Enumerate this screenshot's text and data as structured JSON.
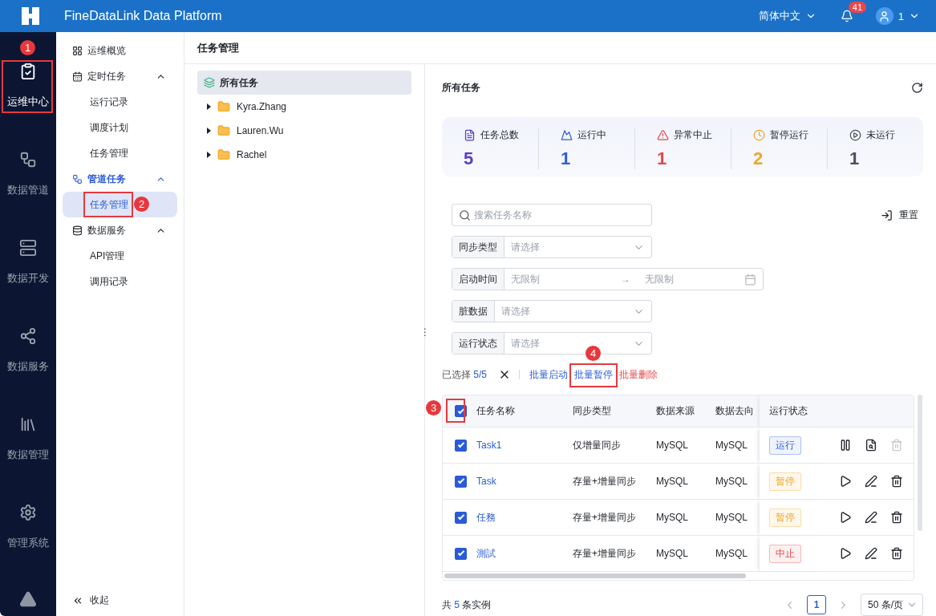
{
  "header": {
    "title": "FineDataLink Data Platform",
    "language": "简体中文",
    "notifications": "41",
    "user": "1"
  },
  "rail": {
    "items": [
      {
        "label": "运维中心",
        "selected": true,
        "callout": {
          "number": "1"
        }
      },
      {
        "label": "数据管道",
        "selected": false
      },
      {
        "label": "数据开发",
        "selected": false
      },
      {
        "label": "数据服务",
        "selected": false
      },
      {
        "label": "数据管理",
        "selected": false
      },
      {
        "label": "管理系统",
        "selected": false
      }
    ]
  },
  "sidebar": {
    "items": [
      {
        "label": "运维概览",
        "kind": "link",
        "selected": false
      },
      {
        "label": "定时任务",
        "kind": "group",
        "selected": false,
        "expanded": true,
        "children": [
          {
            "label": "运行记录",
            "selected": false
          },
          {
            "label": "调度计划",
            "selected": false
          },
          {
            "label": "任务管理",
            "selected": false
          }
        ]
      },
      {
        "label": "管道任务",
        "kind": "group",
        "selected": true,
        "expanded": true,
        "children": [
          {
            "label": "任务管理",
            "selected": true,
            "callout": {
              "number": "2"
            }
          }
        ]
      },
      {
        "label": "数据服务",
        "kind": "group",
        "selected": false,
        "expanded": true,
        "children": [
          {
            "label": "API管理",
            "selected": false
          },
          {
            "label": "调用记录",
            "selected": false
          }
        ]
      }
    ],
    "collapse": "收起"
  },
  "page_title": "任务管理",
  "tree": {
    "root": {
      "label": "所有任务",
      "selected": true
    },
    "folders": [
      {
        "label": "Kyra.Zhang",
        "expanded": false
      },
      {
        "label": "Lauren.Wu",
        "expanded": false
      },
      {
        "label": "Rachel",
        "expanded": false
      }
    ]
  },
  "panel": {
    "resize_handle": "⋮",
    "title": "所有任务",
    "stats": [
      {
        "label": "任务总数",
        "value": "5",
        "color": "#5b3fc4"
      },
      {
        "label": "运行中",
        "value": "1",
        "color": "#2f5ed8"
      },
      {
        "label": "异常中止",
        "value": "1",
        "color": "#e2474b"
      },
      {
        "label": "暂停运行",
        "value": "2",
        "color": "#f0a42a"
      },
      {
        "label": "未运行",
        "value": "1",
        "color": "#4a4f5c"
      }
    ],
    "search": {
      "placeholder": "搜索任务名称"
    },
    "reset": "重置",
    "filters": [
      {
        "kind": "select",
        "label": "同步类型",
        "placeholder": "请选择"
      },
      {
        "kind": "range",
        "label": "启动时间",
        "from": "无限制",
        "separator": "→",
        "to": "无限制"
      },
      {
        "kind": "select",
        "label": "脏数据",
        "placeholder": "请选择"
      },
      {
        "kind": "select",
        "label": "运行状态",
        "placeholder": "请选择"
      }
    ],
    "selection": {
      "label": "已选择",
      "count": "5/5"
    },
    "batch_actions": [
      {
        "label": "批量启动",
        "kind": "primary"
      },
      {
        "label": "批量暂停",
        "kind": "primary",
        "callout": {
          "number": "4"
        }
      },
      {
        "label": "批量删除",
        "kind": "danger"
      }
    ],
    "table": {
      "all_checked": true,
      "header_callout": {
        "number": "3"
      },
      "columns": [
        "任务名称",
        "同步类型",
        "数据来源",
        "数据去向",
        "运行状态"
      ],
      "rows": [
        {
          "checked": true,
          "name": "Task1",
          "sync": "仅增量同步",
          "source": "MySQL",
          "target": "MySQL",
          "status": {
            "label": "运行",
            "kind": "running"
          },
          "actions": [
            {
              "kind": "pause",
              "disabled": false
            },
            {
              "kind": "detail",
              "disabled": false
            },
            {
              "kind": "delete",
              "disabled": true
            }
          ]
        },
        {
          "checked": true,
          "name": "Task",
          "sync": "存量+增量同步",
          "source": "MySQL",
          "target": "MySQL",
          "status": {
            "label": "暂停",
            "kind": "paused"
          },
          "actions": [
            {
              "kind": "play",
              "disabled": false
            },
            {
              "kind": "edit",
              "disabled": false
            },
            {
              "kind": "delete",
              "disabled": false
            }
          ]
        },
        {
          "checked": true,
          "name": "任務",
          "sync": "存量+增量同步",
          "source": "MySQL",
          "target": "MySQL",
          "status": {
            "label": "暂停",
            "kind": "paused"
          },
          "actions": [
            {
              "kind": "play",
              "disabled": false
            },
            {
              "kind": "edit",
              "disabled": false
            },
            {
              "kind": "delete",
              "disabled": false
            }
          ]
        },
        {
          "checked": true,
          "name": "測試",
          "sync": "存量+增量同步",
          "source": "MySQL",
          "target": "MySQL",
          "status": {
            "label": "中止",
            "kind": "stopped"
          },
          "actions": [
            {
              "kind": "play",
              "disabled": false
            },
            {
              "kind": "edit",
              "disabled": false
            },
            {
              "kind": "delete",
              "disabled": false
            }
          ]
        }
      ]
    },
    "footer": {
      "prefix": "共",
      "total": "5",
      "suffix": "条实例",
      "pages": [
        {
          "label": "1",
          "selected": true
        }
      ],
      "page_size": "50 条/页"
    }
  }
}
